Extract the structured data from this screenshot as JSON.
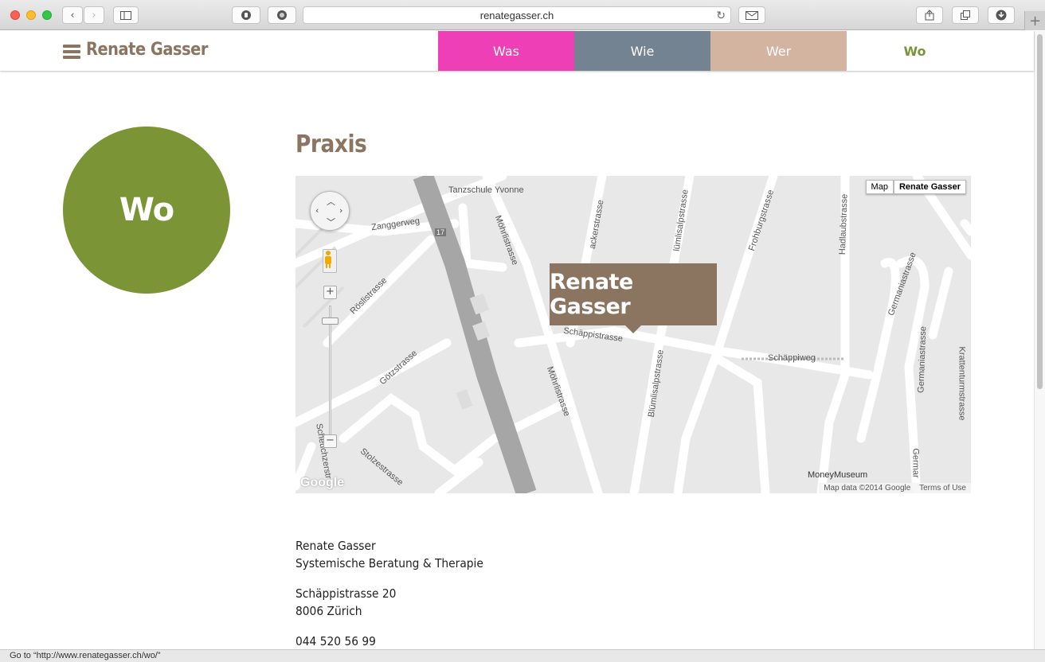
{
  "browser": {
    "url": "renategasser.ch",
    "status_text": "Go to “http://www.renategasser.ch/wo/”"
  },
  "header": {
    "logo": "Renate Gasser",
    "nav": [
      {
        "label": "Was",
        "color": "#ee3fb6"
      },
      {
        "label": "Wie",
        "color": "#748392"
      },
      {
        "label": "Wer",
        "color": "#d2b4a1"
      },
      {
        "label": "Wo",
        "color": "#7a9436",
        "active": true
      }
    ]
  },
  "page": {
    "circle_label": "Wo",
    "section_title": "Praxis"
  },
  "map": {
    "marker_label": "Renate Gasser",
    "map_type": {
      "map": "Map",
      "active": "Renate Gasser"
    },
    "labels": {
      "tanzschule": "Tanzschule Yvonne",
      "zanggerweg": "Zanggerweg",
      "roeslistrasse": "Röslistrasse",
      "moehrlistrasse": "Möhrlistrasse",
      "moehrlistrasse2": "Möhrlistrasse",
      "ackerstrasse": "ackerstrasse",
      "bluemlisalpstrasse_top": "lümlisalpstrasse",
      "bluemlisalpstrasse": "Blümlisalpstrasse",
      "frohburgstrasse": "Frohburgstrasse",
      "hadlaubstrasse": "Hadlaubstrasse",
      "germaniastrasse": "Germaniastrasse",
      "germaniastrasse2": "Germaniastrasse",
      "germania_bottom": "Germar",
      "krattenturmstrasse": "Krattenturmstrasse",
      "schaeppistrasse": "Schäppistrasse",
      "schaeppiweg": "Schäppiweg",
      "goetzstrasse": "Götzstrasse",
      "stolzestrasse": "Stolzestrasse",
      "scheuchzer": "Scheuchzerstr",
      "moneymuseum": "MoneyMuseum",
      "tram17": "17"
    },
    "google": "Google",
    "attribution": "Map data ©2014 Google",
    "terms": "Terms of Use"
  },
  "address": {
    "name": "Renate Gasser",
    "subtitle": "Systemische Beratung & Therapie",
    "street": "Schäppistrasse 20",
    "city": "8006 Zürich",
    "phone": "044 520 56 99"
  }
}
